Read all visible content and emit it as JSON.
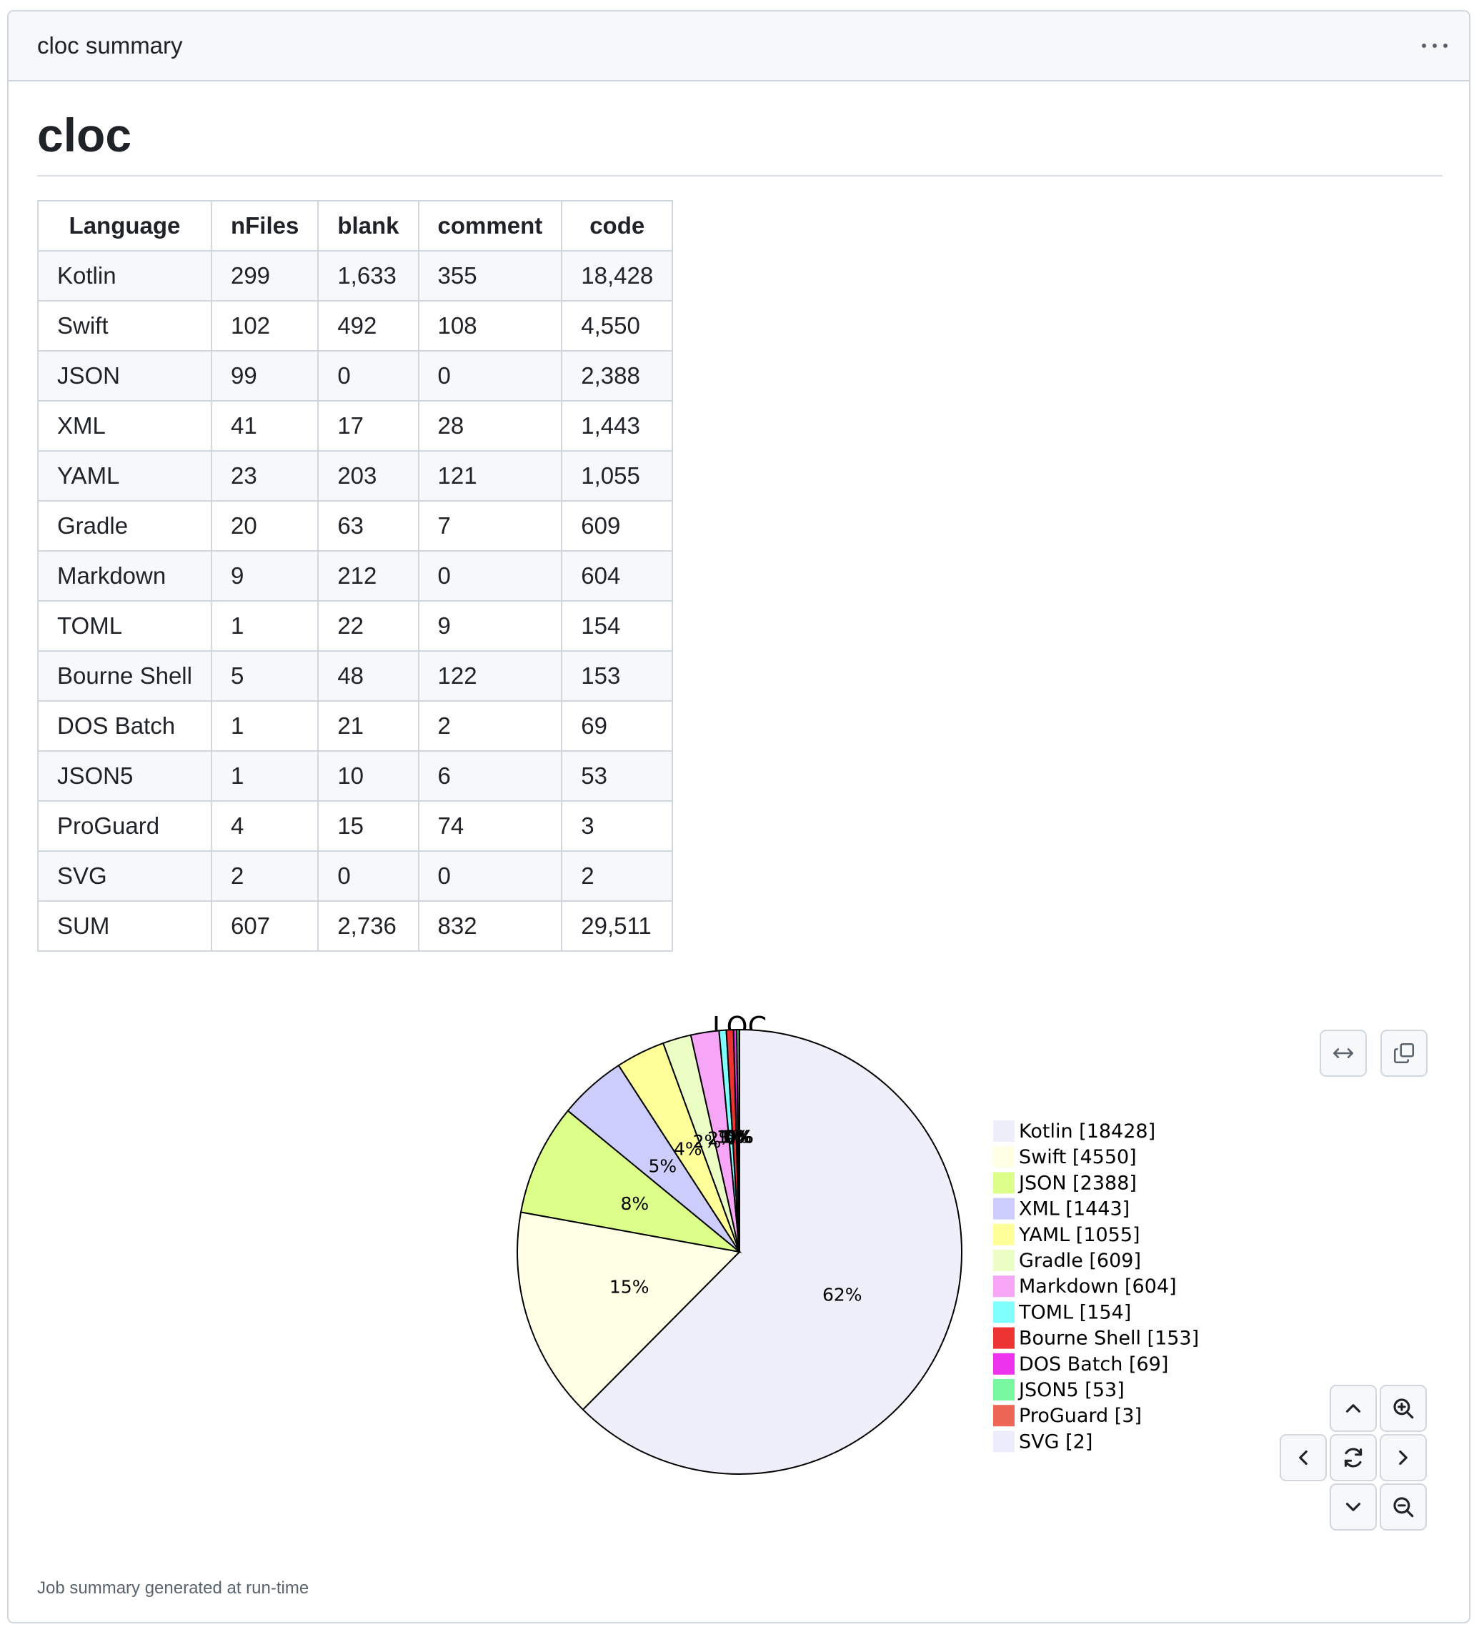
{
  "header": {
    "title": "cloc summary",
    "menu_icon": "kebab-horizontal-icon"
  },
  "document": {
    "heading": "cloc",
    "footer_note": "Job summary generated at run-time"
  },
  "table": {
    "columns": [
      "Language",
      "nFiles",
      "blank",
      "comment",
      "code"
    ],
    "rows": [
      [
        "Kotlin",
        "299",
        "1,633",
        "355",
        "18,428"
      ],
      [
        "Swift",
        "102",
        "492",
        "108",
        "4,550"
      ],
      [
        "JSON",
        "99",
        "0",
        "0",
        "2,388"
      ],
      [
        "XML",
        "41",
        "17",
        "28",
        "1,443"
      ],
      [
        "YAML",
        "23",
        "203",
        "121",
        "1,055"
      ],
      [
        "Gradle",
        "20",
        "63",
        "7",
        "609"
      ],
      [
        "Markdown",
        "9",
        "212",
        "0",
        "604"
      ],
      [
        "TOML",
        "1",
        "22",
        "9",
        "154"
      ],
      [
        "Bourne Shell",
        "5",
        "48",
        "122",
        "153"
      ],
      [
        "DOS Batch",
        "1",
        "21",
        "2",
        "69"
      ],
      [
        "JSON5",
        "1",
        "10",
        "6",
        "53"
      ],
      [
        "ProGuard",
        "4",
        "15",
        "74",
        "3"
      ],
      [
        "SVG",
        "2",
        "0",
        "0",
        "2"
      ],
      [
        "SUM",
        "607",
        "2,736",
        "832",
        "29,511"
      ]
    ]
  },
  "chart_data": {
    "type": "pie",
    "title": "LOC",
    "legend_position": "right",
    "slices": [
      {
        "label": "Kotlin [18428]",
        "value": 18428,
        "color": "#efeffc",
        "pct_label": "62%"
      },
      {
        "label": "Swift [4550]",
        "value": 4550,
        "color": "#ffffe5",
        "pct_label": "15%"
      },
      {
        "label": "JSON [2388]",
        "value": 2388,
        "color": "#dcff8a",
        "pct_label": "8%"
      },
      {
        "label": "XML [1443]",
        "value": 1443,
        "color": "#cccdfc",
        "pct_label": "5%"
      },
      {
        "label": "YAML [1055]",
        "value": 1055,
        "color": "#ffff99",
        "pct_label": "4%"
      },
      {
        "label": "Gradle [609]",
        "value": 609,
        "color": "#ebffc4",
        "pct_label": "2%"
      },
      {
        "label": "Markdown [604]",
        "value": 604,
        "color": "#f7a6f7",
        "pct_label": "2%"
      },
      {
        "label": "TOML [154]",
        "value": 154,
        "color": "#80ffff",
        "pct_label": "1%"
      },
      {
        "label": "Bourne Shell [153]",
        "value": 153,
        "color": "#ee3333",
        "pct_label": "1%"
      },
      {
        "label": "DOS Batch [69]",
        "value": 69,
        "color": "#ee33ee",
        "pct_label": "0%"
      },
      {
        "label": "JSON5 [53]",
        "value": 53,
        "color": "#77f7a0",
        "pct_label": "0%"
      },
      {
        "label": "ProGuard [3]",
        "value": 3,
        "color": "#ee6655",
        "pct_label": "0%"
      },
      {
        "label": "SVG [2]",
        "value": 2,
        "color": "#ececfa",
        "pct_label": "0%"
      }
    ]
  },
  "toolbar": {
    "fit_width_icon": "arrows-horizontal-icon",
    "copy_icon": "copy-icon",
    "pan_up_icon": "chevron-up-icon",
    "pan_down_icon": "chevron-down-icon",
    "pan_left_icon": "chevron-left-icon",
    "pan_right_icon": "chevron-right-icon",
    "reset_icon": "reset-icon",
    "zoom_in_icon": "zoom-in-icon",
    "zoom_out_icon": "zoom-out-icon"
  }
}
